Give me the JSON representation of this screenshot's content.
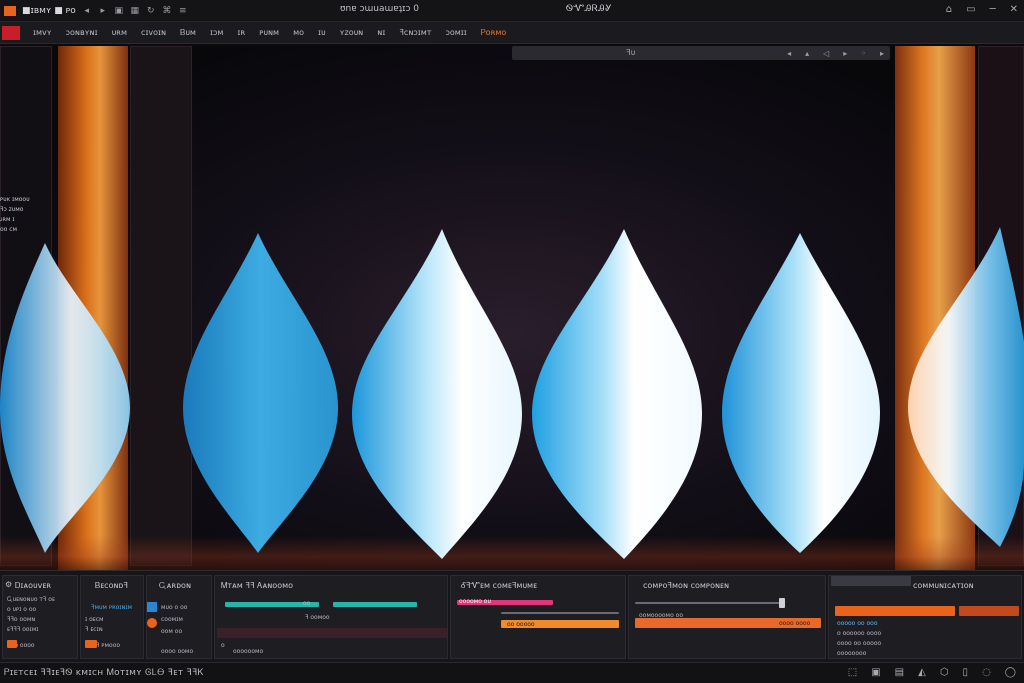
{
  "window": {
    "app_name": "■ɪʙᴍʏ ■ ᴘᴏ",
    "center_tab": "ʊnɐ ɔɯuaɯɐʇɪɔ 0",
    "title": "ᏫᏉᎯᏒᎯᎽ",
    "controls": [
      "⌂",
      "▭",
      "─",
      "✕"
    ]
  },
  "menu": {
    "items": [
      "ɪᴍᴠʏ",
      "ɔᴏɴʙʏɴɪ",
      "ᴜʀᴍ",
      "ᴄɪᴠᴏɪɴ",
      "Ᏼᴜᴍ",
      "ɪɔᴍ",
      "ɪʀ",
      "ᴘᴜɴᴍ",
      "ᴍᴏ",
      "ɪᴜ",
      "ʏᴢᴏᴜɴ",
      "ɴɪ",
      "ꟻᴄɴɔɪᴍᴛ",
      "ɔᴏᴍɪɪ",
      "Ꮲᴏʀᴍᴏ"
    ],
    "accent_index": 14
  },
  "toolstrip": {
    "label": "ꟻᴜ",
    "icons": [
      "◂",
      "▴",
      "◁",
      "▸",
      "◦",
      "▸"
    ]
  },
  "left_info": [
    "ᴘᴜᴋ ɪᴍᴏᴏᴜ",
    "ꟻɔ ᴢᴜᴍᴏ",
    "ᴊʀᴍ ɪ",
    "ᴏᴏ ᴄᴍ"
  ],
  "bottom": {
    "panels": [
      {
        "title": "Ꭰɪᴀᴏᴜᴠᴇʀ",
        "rows": [
          "Ꮹᴜᴇɴᴏɴᴜᴏ ᴛꟻ ᴏᴇ",
          "ᴏ ᴜᴘɪ ᴏ ᴏᴏ",
          "ꟻꟻᴏ ᴏᴏᴍɴ",
          "ᴇꟻꟻꟻ ᴏᴏɪᴍɪ",
          "ᴏᴏᴏ ᴏᴏᴏᴏ"
        ]
      },
      {
        "title": "Ᏼᴇᴄᴏɴᴅꟻ",
        "rows": [
          "ꟻᴍᴜᴍ ᴘʀᴏɪɴɪᴍ",
          "ɪ ᴏᴇᴄᴍ",
          "ꟻ ᴇᴄɪɴ",
          "ᴏᴏᴏꟻ ᴘᴍᴏᴏᴏ"
        ]
      },
      {
        "title": "Ꮹᴀʀᴅᴏɴ",
        "rows": [
          "ᴍᴜᴏ ᴏ ᴏᴏ",
          "ᴄᴏᴏᴍɪᴍ",
          "ᴏᴏᴍ ᴏᴏ",
          "ᴏᴏᴏᴏ ᴏᴏᴍᴏ"
        ]
      },
      {
        "title": "Ꮇᴛᴀᴍ ꟻꟻ Ꭺᴀɴᴏᴏᴍᴏ",
        "rows": [
          "ᴏᴏ",
          "ꟻ ᴏᴏᴍᴏᴏ",
          "ᴏ",
          "ᴏᴏᴏᴏᴏᴏᴍᴏ"
        ]
      },
      {
        "title": "ᎴꟻᏉᴇᴍ ᴄᴏᴍᴇꟻᴍᴜᴍᴇ",
        "rows": [
          "ᴏᴏᴏᴏᴍᴏ ᴏᴜ",
          "ᴏᴏ ᴏᴏᴏᴏᴏ"
        ]
      },
      {
        "title": "ᴄᴏᴍᴘᴏꟻᴍᴏɴ ᴄᴏᴍᴘᴏɴᴇɴ",
        "rows": [
          "ᴏᴏᴍᴏᴏᴏᴏᴍᴏ ᴏᴏ",
          "ᴏᴏᴏᴏ ᴏᴏᴏᴏ"
        ]
      },
      {
        "title": "ᴄᴏᴍᴍᴜɴɪᴄᴀᴛɪᴏɴ",
        "rows": [
          "ᴏᴏᴏᴏᴏ ᴏᴏ ᴏᴏᴏ",
          "ᴏ ᴏᴏᴏᴏᴏᴏ ᴏᴏᴏᴏ",
          "ᴏᴏᴏᴏ ᴏᴏ ᴏᴏᴏᴏᴏ",
          "ᴏᴏᴏᴏᴏᴏᴏᴏ"
        ]
      }
    ]
  },
  "status": {
    "text": "Ꮲɪᴇᴛᴄᴇɪ ꟻꟻɪᴇꟻᏫ ᴋᴍɪᴄʜ Ꮇᴏᴛɪᴍʏ ᎶᏞᎾ ꟻᴇᴛ ꟻꟻᏦ",
    "icons": [
      "⬚",
      "▣",
      "▤",
      "◭",
      "⬡",
      "▯",
      "◌",
      "◯"
    ]
  },
  "colors": {
    "accent_orange": "#e8641c",
    "logo_red": "#c81e2a",
    "gem_cyan": "#2fb8f0",
    "gem_white": "#f4fbff",
    "bar_teal": "#26b5a8",
    "bar_pink": "#e0357a",
    "bar_orange": "#f08a2a"
  }
}
